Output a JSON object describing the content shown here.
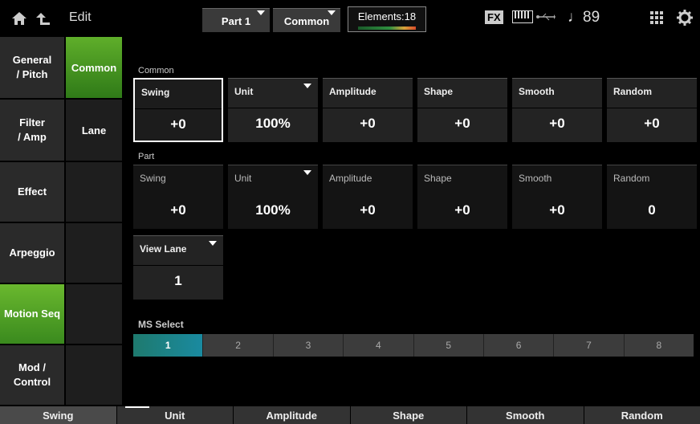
{
  "header": {
    "title": "Edit",
    "part_label": "Part 1",
    "common_label": "Common",
    "elements_label": "Elements:18",
    "fx_label": "FX",
    "note_glyph": "♩",
    "tempo": "89"
  },
  "categories": [
    {
      "label": "General\n/ Pitch"
    },
    {
      "label": "Filter\n/ Amp"
    },
    {
      "label": "Effect"
    },
    {
      "label": "Arpeggio"
    },
    {
      "label": "Motion Seq"
    },
    {
      "label": "Mod /\nControl"
    }
  ],
  "subtabs": [
    {
      "label": "Common"
    },
    {
      "label": "Lane"
    }
  ],
  "common_section": {
    "label": "Common",
    "params": [
      {
        "name": "Swing",
        "value": "+0"
      },
      {
        "name": "Unit",
        "value": "100%"
      },
      {
        "name": "Amplitude",
        "value": "+0"
      },
      {
        "name": "Shape",
        "value": "+0"
      },
      {
        "name": "Smooth",
        "value": "+0"
      },
      {
        "name": "Random",
        "value": "+0"
      }
    ]
  },
  "part_section": {
    "label": "Part",
    "params": [
      {
        "name": "Swing",
        "value": "+0"
      },
      {
        "name": "Unit",
        "value": "100%"
      },
      {
        "name": "Amplitude",
        "value": "+0"
      },
      {
        "name": "Shape",
        "value": "+0"
      },
      {
        "name": "Smooth",
        "value": "+0"
      },
      {
        "name": "Random",
        "value": "0"
      }
    ]
  },
  "view_lane": {
    "name": "View Lane",
    "value": "1"
  },
  "ms_select": {
    "label": "MS Select",
    "items": [
      "1",
      "2",
      "3",
      "4",
      "5",
      "6",
      "7",
      "8"
    ],
    "selected": "1"
  },
  "bottom_bar": [
    "Swing",
    "Unit",
    "Amplitude",
    "Shape",
    "Smooth",
    "Random"
  ],
  "colors": {
    "accent_green": "#5fae2a",
    "ms_selected": "#1a8aa0"
  }
}
